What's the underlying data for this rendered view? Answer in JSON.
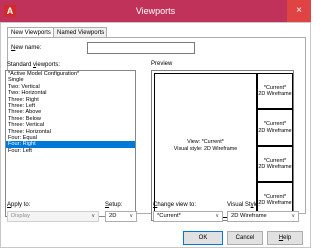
{
  "window": {
    "title": "Viewports",
    "app_icon": "A",
    "close_glyph": "×"
  },
  "tabs": [
    {
      "label": "New Viewports",
      "active": true
    },
    {
      "label": "Named Viewports",
      "active": false
    }
  ],
  "new_name": {
    "label_u": "N",
    "label_rest": "ew name:",
    "value": ""
  },
  "standard_viewports": {
    "label_a": "Standard ",
    "label_u": "v",
    "label_b": "iewports:",
    "items": [
      "*Active Model Configuration*",
      "Single",
      "Two:  Vertical",
      "Two:  Horizontal",
      "Three: Right",
      "Three: Left",
      "Three: Above",
      "Three: Below",
      "Three: Vertical",
      "Three: Horizontal",
      "Four:  Equal",
      "Four:  Right",
      "Four:  Left"
    ],
    "selected_index": 11
  },
  "preview": {
    "label": "Preview",
    "main_line1": "View: *Current*",
    "main_line2": "Visual style: 2D Wireframe",
    "side_line1": "*Current*",
    "side_line2": "2D Wireframe"
  },
  "apply_to": {
    "label_u": "A",
    "label_rest": "pply to:",
    "value": "Display"
  },
  "setup": {
    "label_u": "S",
    "label_rest": "etup:",
    "value": "2D"
  },
  "change_view": {
    "label_u": "C",
    "label_rest": "hange view to:",
    "value": "*Current*"
  },
  "visual_style": {
    "label_a": "Visual St",
    "label_u": "y",
    "label_b": "le:",
    "value": "2D Wireframe"
  },
  "buttons": {
    "ok": "OK",
    "cancel": "Cancel",
    "help_u": "H",
    "help_rest": "elp"
  },
  "colors": {
    "titlebar": "#c0325a",
    "selection": "#0078d7"
  }
}
